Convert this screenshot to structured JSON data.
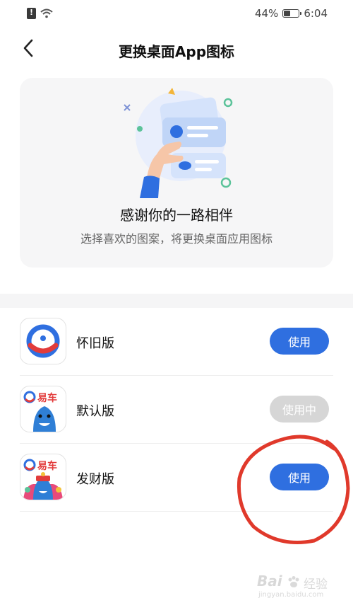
{
  "status_bar": {
    "battery": "44%",
    "time": "6:04"
  },
  "header": {
    "title": "更换桌面App图标"
  },
  "hero": {
    "title": "感谢你的一路相伴",
    "subtitle": "选择喜欢的图案，将更换桌面应用图标"
  },
  "icon_options": [
    {
      "label": "怀旧版",
      "button": "使用",
      "state": "available",
      "icon": "yiche-classic-logo-icon"
    },
    {
      "label": "默认版",
      "button": "使用中",
      "state": "in_use",
      "icon": "yiche-shark-icon",
      "brand": "易车"
    },
    {
      "label": "发财版",
      "button": "使用",
      "state": "available",
      "icon": "yiche-fortune-icon",
      "brand": "易车"
    }
  ],
  "watermark": {
    "logo": "Bai",
    "text": "经验",
    "url": "jingyan.baidu.com"
  },
  "colors": {
    "accent": "#2f6fe0",
    "in_use": "#d6d6d6",
    "annotation": "#e0392b",
    "brand_red": "#e23b3b"
  }
}
